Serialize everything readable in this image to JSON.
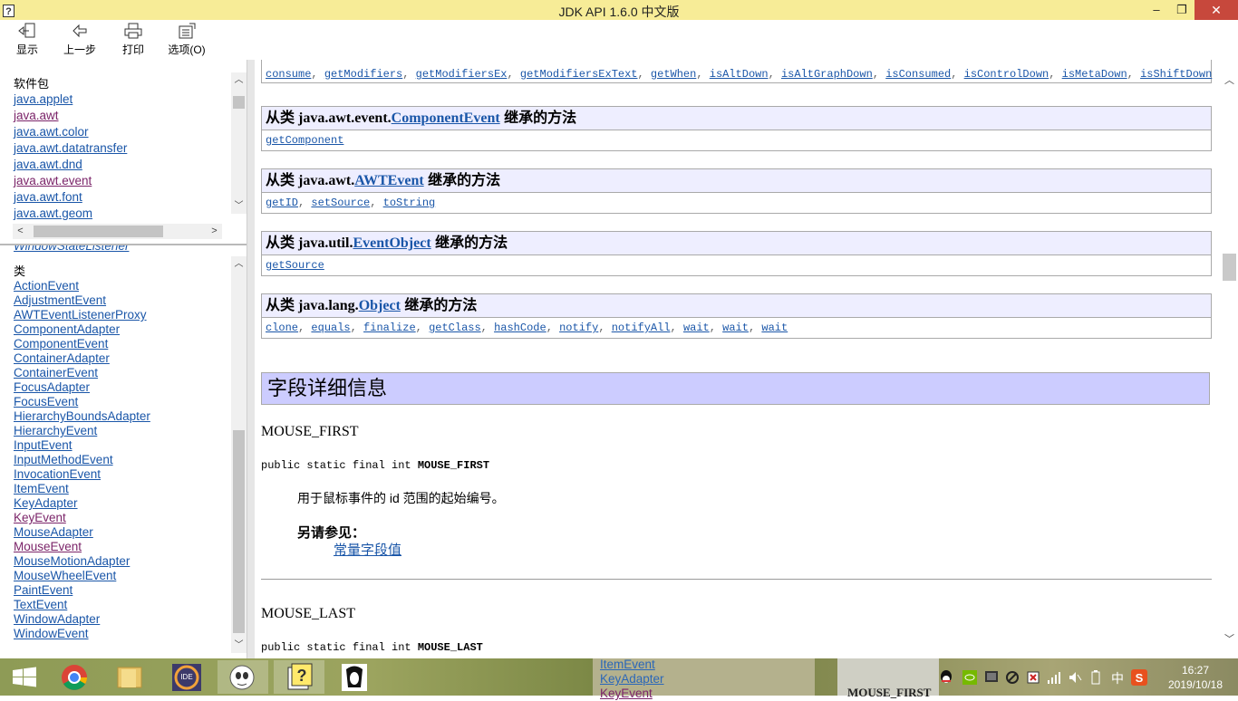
{
  "window": {
    "title": "JDK API 1.6.0 中文版",
    "minimize": "–",
    "maximize": "❐",
    "close": "✕"
  },
  "toolbar": {
    "show": "显示",
    "back": "上一步",
    "print": "打印",
    "options": "选项(O)"
  },
  "packages": {
    "heading": "软件包",
    "items": [
      "java.applet",
      "java.awt",
      "java.awt.color",
      "java.awt.datatransfer",
      "java.awt.dnd",
      "java.awt.event",
      "java.awt.font",
      "java.awt.geom"
    ]
  },
  "classes": {
    "partial_top": "WindowStateListener",
    "heading": "类",
    "items": [
      "ActionEvent",
      "AdjustmentEvent",
      "AWTEventListenerProxy",
      "ComponentAdapter",
      "ComponentEvent",
      "ContainerAdapter",
      "ContainerEvent",
      "FocusAdapter",
      "FocusEvent",
      "HierarchyBoundsAdapter",
      "HierarchyEvent",
      "InputEvent",
      "InputMethodEvent",
      "InvocationEvent",
      "ItemEvent",
      "KeyAdapter",
      "KeyEvent",
      "MouseAdapter",
      "MouseEvent",
      "MouseMotionAdapter",
      "MouseWheelEvent",
      "PaintEvent",
      "TextEvent",
      "WindowAdapter",
      "WindowEvent"
    ],
    "visited": [
      "java.awt",
      "java.awt.event",
      "KeyEvent",
      "MouseEvent"
    ]
  },
  "inherited": {
    "top_methods": [
      "consume",
      "getModifiers",
      "getModifiersEx",
      "getModifiersExText",
      "getWhen",
      "isAltDown",
      "isAltGraphDown",
      "isConsumed",
      "isControlDown",
      "isMetaDown",
      "isShiftDown"
    ],
    "blocks": [
      {
        "prefix": "从类 java.awt.event.",
        "link": "ComponentEvent",
        "suffix": " 继承的方法",
        "methods": [
          "getComponent"
        ]
      },
      {
        "prefix": "从类 java.awt.",
        "link": "AWTEvent",
        "suffix": " 继承的方法",
        "methods": [
          "getID",
          "setSource",
          "toString"
        ]
      },
      {
        "prefix": "从类 java.util.",
        "link": "EventObject",
        "suffix": " 继承的方法",
        "methods": [
          "getSource"
        ]
      },
      {
        "prefix": "从类 java.lang.",
        "link": "Object",
        "suffix": " 继承的方法",
        "methods": [
          "clone",
          "equals",
          "finalize",
          "getClass",
          "hashCode",
          "notify",
          "notifyAll",
          "wait",
          "wait",
          "wait"
        ]
      }
    ]
  },
  "field_detail": {
    "heading": "字段详细信息",
    "f1_name": "MOUSE_FIRST",
    "f1_sig_prefix": "public static final int ",
    "f1_sig_name": "MOUSE_FIRST",
    "f1_desc": "用于鼠标事件的 id 范围的起始编号。",
    "see_also": "另请参见：",
    "see_link": "常量字段值",
    "f2_name": "MOUSE_LAST",
    "f2_sig_prefix": "public static final int ",
    "f2_sig_name": "MOUSE_LAST"
  },
  "taskbar": {
    "apps": [
      "windows-start",
      "chrome",
      "file-explorer",
      "java-ee-ide",
      "gimp",
      "help-viewer",
      "che-avatar"
    ],
    "peek_items": [
      "ItemEvent",
      "KeyAdapter",
      "KeyEvent"
    ],
    "peek_heading": "MOUSE_FIRST",
    "tray_lang": "中",
    "time": "16:27",
    "date": "2019/10/18"
  },
  "colors": {
    "link": "#1a56a8",
    "visited": "#7b2469",
    "titlebar": "#f7ec97",
    "close": "#c7483c",
    "section": "#ccccff",
    "inherit_head": "#eeeeff"
  }
}
